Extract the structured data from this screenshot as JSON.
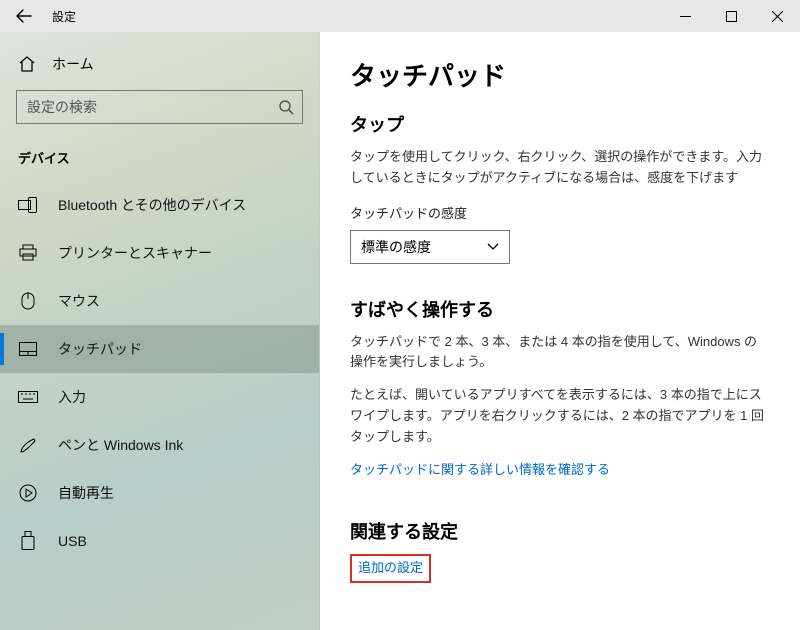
{
  "titlebar": {
    "title": "設定"
  },
  "sidebar": {
    "home_label": "ホーム",
    "search_placeholder": "設定の検索",
    "category_label": "デバイス",
    "items": [
      {
        "label": "Bluetooth とその他のデバイス"
      },
      {
        "label": "プリンターとスキャナー"
      },
      {
        "label": "マウス"
      },
      {
        "label": "タッチパッド"
      },
      {
        "label": "入力"
      },
      {
        "label": "ペンと Windows Ink"
      },
      {
        "label": "自動再生"
      },
      {
        "label": "USB"
      }
    ]
  },
  "content": {
    "page_title": "タッチパッド",
    "tap": {
      "heading": "タップ",
      "desc": "タップを使用してクリック、右クリック、選択の操作ができます。入力しているときにタップがアクティブになる場合は、感度を下げます",
      "sensitivity_label": "タッチパッドの感度",
      "sensitivity_value": "標準の感度"
    },
    "gestures": {
      "heading": "すばやく操作する",
      "desc1": "タッチパッドで 2 本、3 本、または 4 本の指を使用して、Windows の操作を実行しましょう。",
      "desc2": "たとえば、開いているアプリすべてを表示するには、3 本の指で上にスワイプします。アプリを右クリックするには、2 本の指でアプリを 1 回タップします。",
      "info_link": "タッチパッドに関する詳しい情報を確認する"
    },
    "related": {
      "heading": "関連する設定",
      "link": "追加の設定"
    }
  }
}
